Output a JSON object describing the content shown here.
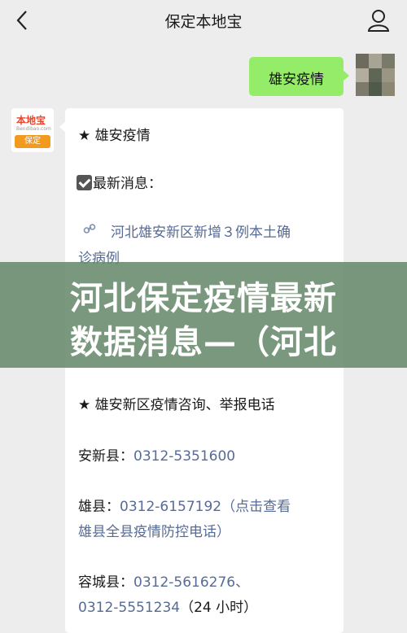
{
  "header": {
    "title": "保定本地宝"
  },
  "messages": {
    "me": {
      "text": "雄安疫情"
    },
    "bot": {
      "avatar_logo": "本地宝",
      "avatar_sub": "Bendibao.com",
      "avatar_tag": "保定",
      "heading": "★ 雄安疫情",
      "latest_label": "最新消息：",
      "link_line1": "河北雄安新区新增３例本土确",
      "link_line2": "诊病例",
      "hotline_heading": "★ 雄安新区疫情咨询、举报电话",
      "anxin_label": "安新县：",
      "anxin_phone": "0312-5351600",
      "xiong_label": "雄县：",
      "xiong_phone": "0312-6157192",
      "xiong_note1": "（点击查看",
      "xiong_note2": "雄县全县疫情防控电话）",
      "rongcheng_label": "容城县：",
      "rongcheng_phone1": "0312-5616276、",
      "rongcheng_phone2": "0312-5551234",
      "rongcheng_note": "（24 小时）"
    }
  },
  "overlay": {
    "line1": "河北保定疫情最新",
    "line2": "数据消息—（河北"
  },
  "colors": {
    "bubble_me": "#95ec69",
    "link": "#576b95",
    "overlay": "#668a6c"
  },
  "icons": [
    "back-arrow-icon",
    "user-profile-icon",
    "link-icon",
    "checkbox-icon"
  ]
}
